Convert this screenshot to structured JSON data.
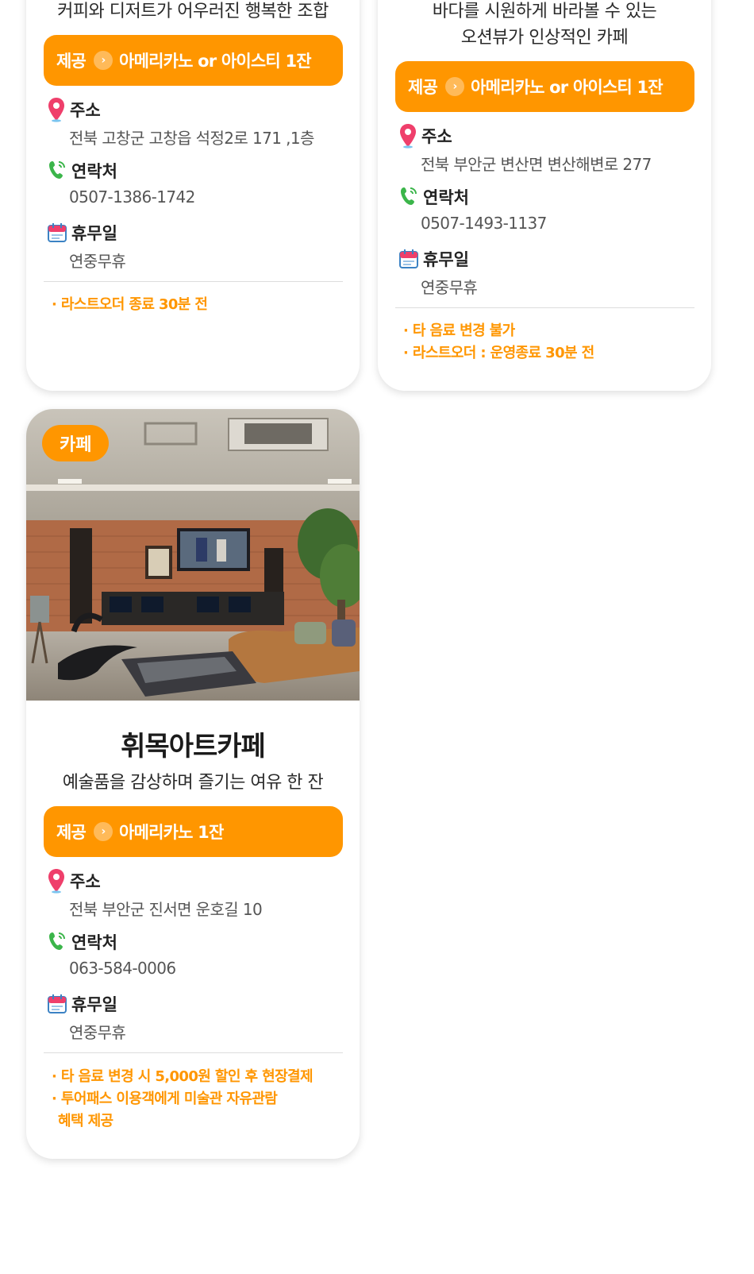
{
  "cards": [
    {
      "description_lines": [
        "커피와 디저트가 어우러진 행복한 조합"
      ],
      "offer": {
        "prefix": "제공",
        "item": "아메리카노 or 아이스티 1잔"
      },
      "address": {
        "label": "주소",
        "value": "전북 고창군 고창읍 석정2로 171 ,1층"
      },
      "contact": {
        "label": "연락처",
        "value": "0507-1386-1742"
      },
      "holiday": {
        "label": "휴무일",
        "value": "연중무휴"
      },
      "notes": [
        "· 라스트오더 종료 30분 전"
      ]
    },
    {
      "description_lines": [
        "바다를 시원하게 바라볼 수 있는",
        "오션뷰가 인상적인 카페"
      ],
      "offer": {
        "prefix": "제공",
        "item": "아메리카노 or 아이스티 1잔"
      },
      "address": {
        "label": "주소",
        "value": "전북 부안군 변산면 변산해변로 277"
      },
      "contact": {
        "label": "연락처",
        "value": "0507-1493-1137"
      },
      "holiday": {
        "label": "휴무일",
        "value": "연중무휴"
      },
      "notes": [
        "· 타 음료 변경 불가",
        "· 라스트오더 : 운영종료 30분 전"
      ]
    },
    {
      "category_badge": "카페",
      "name": "휘목아트카페",
      "description_lines": [
        "예술품을 감상하며 즐기는 여유 한 잔"
      ],
      "offer": {
        "prefix": "제공",
        "item": "아메리카노 1잔"
      },
      "address": {
        "label": "주소",
        "value": "전북 부안군 진서면 운호길 10"
      },
      "contact": {
        "label": "연락처",
        "value": "063-584-0006"
      },
      "holiday": {
        "label": "휴무일",
        "value": "연중무휴"
      },
      "notes": [
        "· 타 음료 변경 시 5,000원 할인 후 현장결제",
        "· 투어패스 이용객에게 미술관 자유관람",
        "혜택 제공"
      ]
    }
  ],
  "theme": {
    "accent": "#ff9600",
    "pin": "#ef3f6b",
    "phone": "#3bb54a",
    "calendar": "#3b82c4"
  }
}
